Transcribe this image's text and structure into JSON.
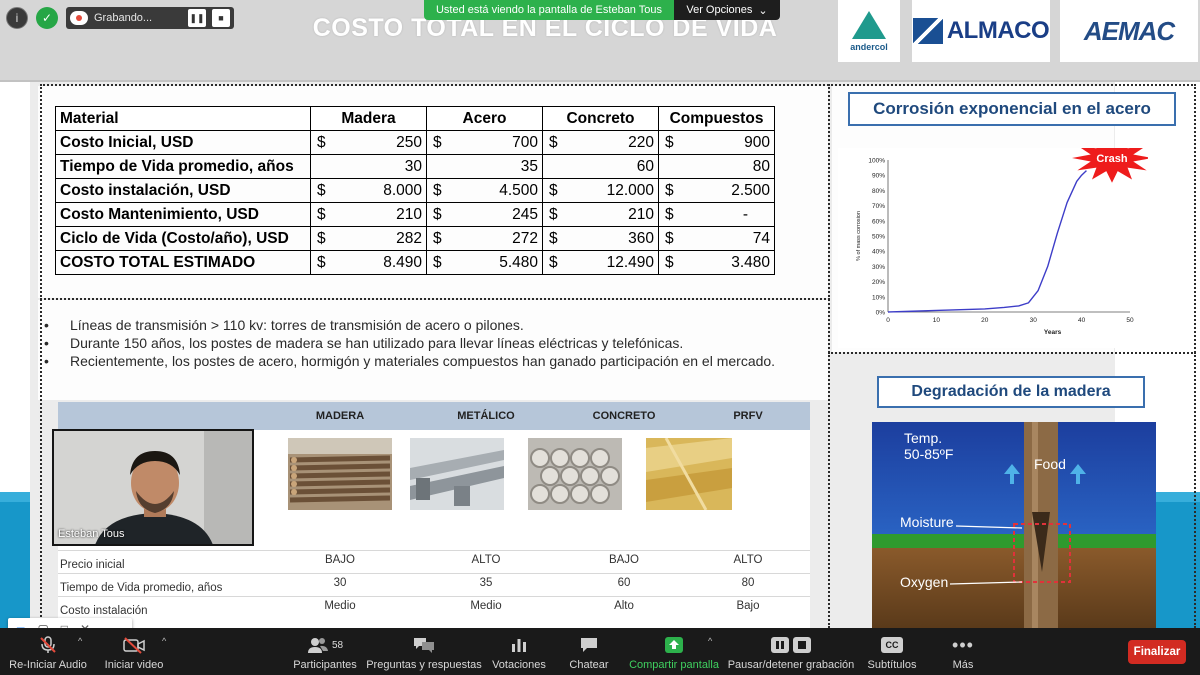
{
  "zoom_top": {
    "recording_label": "Grabando...",
    "share_banner": "Usted está viendo la pantalla de Esteban Tous",
    "view_options": "Ver Opciones"
  },
  "slide": {
    "title": "COSTO TOTAL EN EL CICLO DE VIDA",
    "logos": {
      "andercol": "andercol",
      "almaco": "ALMACO",
      "aemac": "AEMAC"
    },
    "cost_table": {
      "headers": [
        "Material",
        "Madera",
        "Acero",
        "Concreto",
        "Compuestos"
      ],
      "rows": [
        {
          "label": "Costo Inicial, USD",
          "cur": [
            "$",
            "$",
            "$",
            "$"
          ],
          "values": [
            "250",
            "700",
            "220",
            "900"
          ]
        },
        {
          "label": "Tiempo de Vida promedio, años",
          "cur": [
            "",
            "",
            "",
            ""
          ],
          "values": [
            "30",
            "35",
            "60",
            "80"
          ]
        },
        {
          "label": "Costo instalación, USD",
          "cur": [
            "$",
            "$",
            "$",
            "$"
          ],
          "values": [
            "8.000",
            "4.500",
            "12.000",
            "2.500"
          ]
        },
        {
          "label": "Costo Mantenimiento, USD",
          "cur": [
            "$",
            "$",
            "$",
            "$"
          ],
          "values": [
            "210",
            "245",
            "210",
            "-"
          ]
        },
        {
          "label": "Ciclo de Vida (Costo/año), USD",
          "cur": [
            "$",
            "$",
            "$",
            "$"
          ],
          "values": [
            "282",
            "272",
            "360",
            "74"
          ]
        },
        {
          "label": "COSTO TOTAL ESTIMADO",
          "cur": [
            "$",
            "$",
            "$",
            "$"
          ],
          "values": [
            "8.490",
            "5.480",
            "12.490",
            "3.480"
          ]
        }
      ]
    },
    "bullets": [
      "Líneas de transmisión > 110 kv: torres de transmisión de acero o pilones.",
      "Durante 150 años, los postes de madera se han utilizado para llevar líneas eléctricas y telefónicas.",
      "Recientemente, los postes de acero, hormigón y materiales compuestos han ganado participación en el mercado."
    ],
    "comparison": {
      "columns": [
        "MADERA",
        "METÁLICO",
        "CONCRETO",
        "PRFV"
      ],
      "rows": [
        {
          "label": "Precio inicial",
          "values": [
            "BAJO",
            "ALTO",
            "BAJO",
            "ALTO"
          ]
        },
        {
          "label": "Tiempo de Vida promedio, años",
          "values": [
            "30",
            "35",
            "60",
            "80"
          ]
        },
        {
          "label": "Costo instalación",
          "values": [
            "Medio",
            "Medio",
            "Alto",
            "Bajo"
          ]
        }
      ]
    },
    "corrosion": {
      "title": "Corrosión exponencial en el acero",
      "crash_label": "Crash"
    },
    "wood": {
      "title": "Degradación de la madera",
      "labels": {
        "temp": "Temp.",
        "temp_range": "50-85ºF",
        "food": "Food",
        "moisture": "Moisture",
        "oxygen": "Oxygen"
      }
    }
  },
  "chart_data": {
    "type": "line",
    "title": "",
    "xlabel": "Years",
    "ylabel": "% of mass corrosion",
    "xlim": [
      0,
      50
    ],
    "ylim": [
      0,
      100
    ],
    "x_ticks": [
      0,
      10,
      20,
      30,
      40,
      50
    ],
    "y_ticks": [
      "0%",
      "10%",
      "20%",
      "30%",
      "40%",
      "50%",
      "60%",
      "70%",
      "80%",
      "90%",
      "100%"
    ],
    "series": [
      {
        "color": "#3d3dc8",
        "x": [
          0,
          5,
          10,
          15,
          20,
          24,
          27,
          29,
          31,
          33,
          35,
          37,
          39,
          40,
          41
        ],
        "y": [
          0,
          0.5,
          1,
          1.5,
          2,
          3,
          4,
          6,
          14,
          30,
          52,
          72,
          86,
          90,
          93
        ]
      }
    ],
    "annotations": [
      "Crash"
    ],
    "grid": false
  },
  "webcam": {
    "name": "Esteban Tous"
  },
  "toolbar": {
    "audio": "Re-Iniciar Audio",
    "video": "Iniciar video",
    "participants": "Participantes",
    "participants_count": "58",
    "qa": "Preguntas y respuestas",
    "polls": "Votaciones",
    "chat": "Chatear",
    "share": "Compartir pantalla",
    "record": "Pausar/detener grabación",
    "subtitles": "Subtítulos",
    "more": "Más",
    "end": "Finalizar",
    "cc_icon": "CC"
  },
  "colors": {
    "share_green": "#2db14c",
    "end_red": "#d22b22",
    "slide_teal": "#1797c9",
    "title_blue": "#1f497d"
  }
}
